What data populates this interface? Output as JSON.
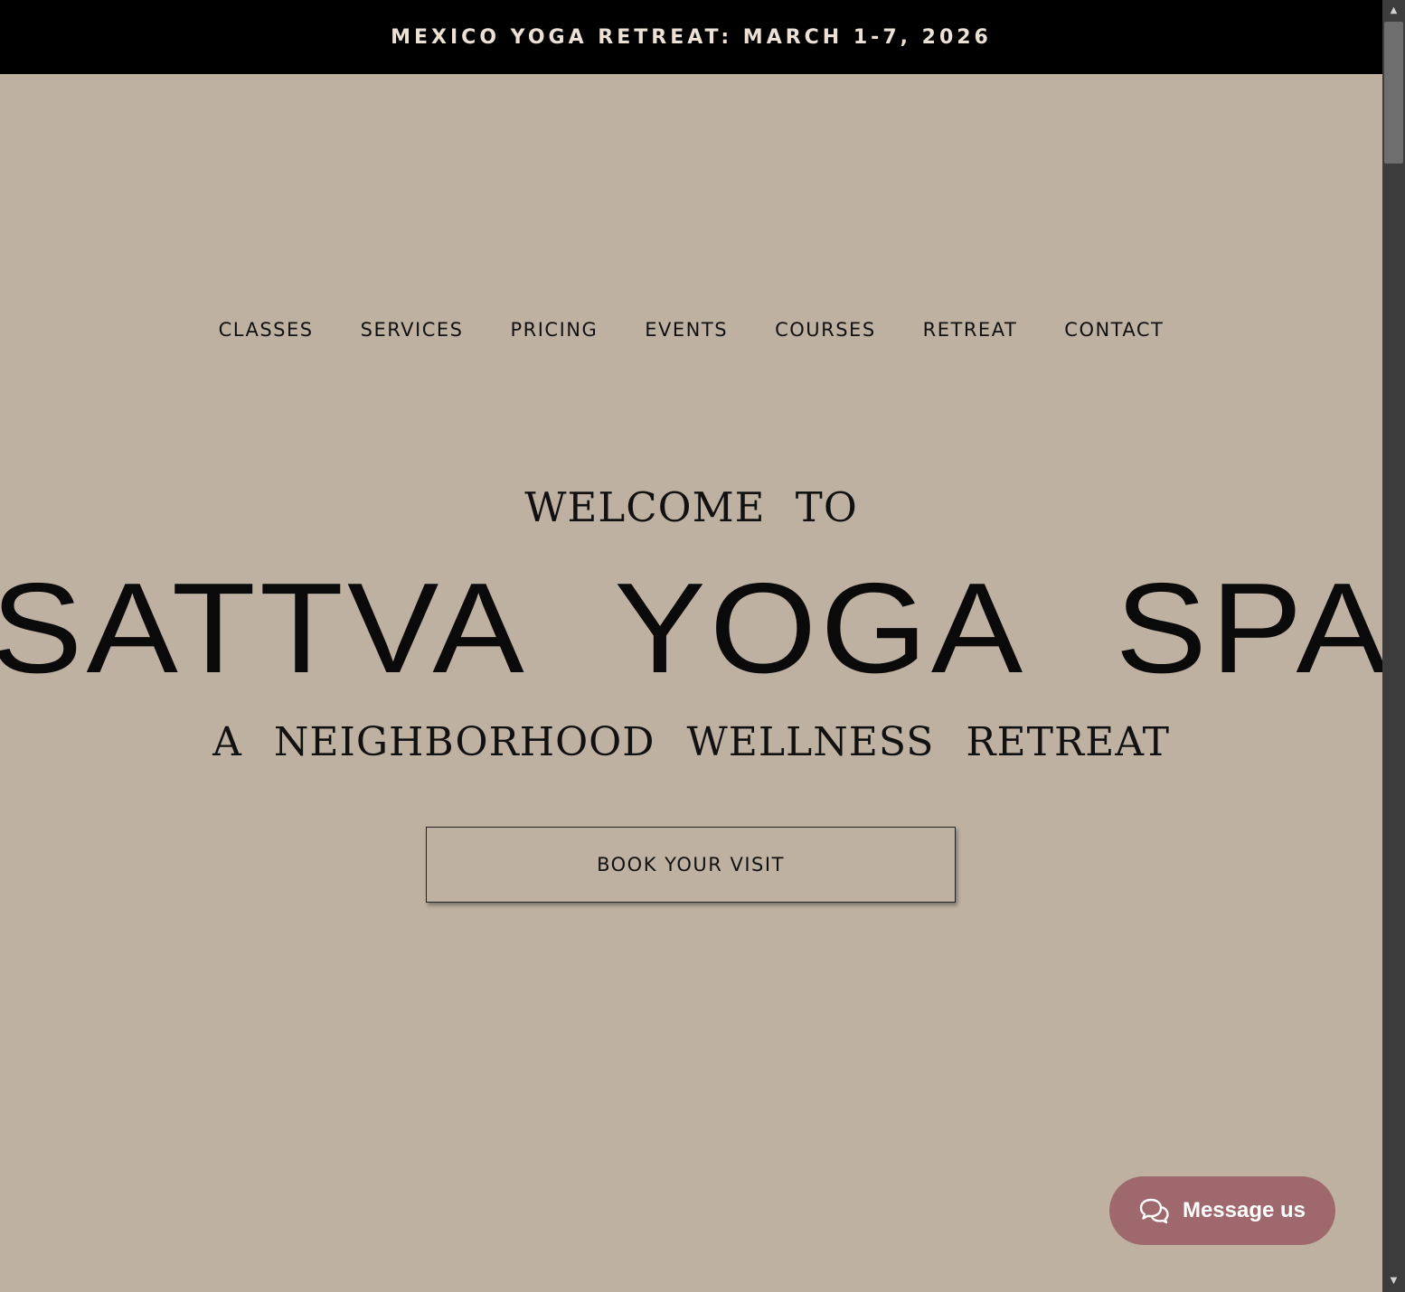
{
  "announcement": {
    "text": "MEXICO YOGA RETREAT: MARCH 1-7, 2026"
  },
  "nav": {
    "items": [
      {
        "label": "CLASSES"
      },
      {
        "label": "SERVICES"
      },
      {
        "label": "PRICING"
      },
      {
        "label": "EVENTS"
      },
      {
        "label": "COURSES"
      },
      {
        "label": "RETREAT"
      },
      {
        "label": "CONTACT"
      }
    ]
  },
  "hero": {
    "welcome": "WELCOME TO",
    "brand": "SATTVA YOGA SPA",
    "tagline": "A NEIGHBORHOOD WELLNESS RETREAT",
    "cta_label": "BOOK YOUR VISIT"
  },
  "chat_widget": {
    "label": "Message us",
    "icon": "chat-bubbles-icon",
    "color": "#9e686c"
  },
  "colors": {
    "background": "#bfb1a2",
    "announcement_bar": "#000000",
    "announcement_text": "#ece1d4"
  },
  "scrollbar": {
    "up_icon": "scroll-up-arrow-icon",
    "down_icon": "scroll-down-arrow-icon"
  }
}
